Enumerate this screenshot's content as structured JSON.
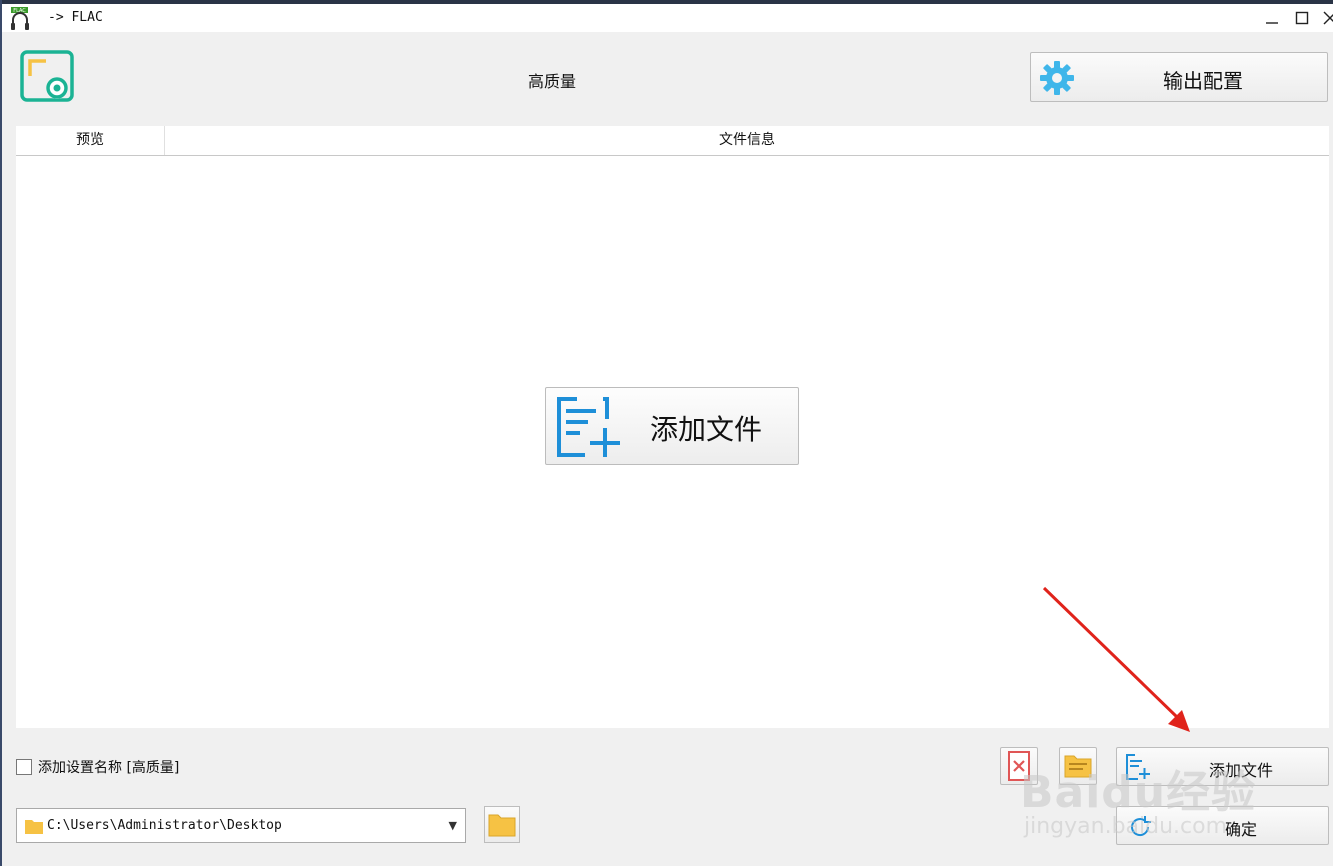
{
  "window": {
    "title": "-> FLAC",
    "app_icon_badge": "FLAC"
  },
  "header": {
    "preset_name": "高质量",
    "output_config_label": "输出配置"
  },
  "file_list": {
    "columns": [
      "预览",
      "文件信息"
    ],
    "add_file_button": "添加文件"
  },
  "footer": {
    "add_setting_name_label": "添加设置名称 [高质量]",
    "add_setting_name_checked": false,
    "add_file_small_label": "添加文件",
    "output_path": "C:\\Users\\Administrator\\Desktop",
    "ok_label": "确定"
  },
  "icons": [
    "app-headphones-icon",
    "minimize-icon",
    "maximize-icon",
    "close-icon",
    "preset-screen-icon",
    "gear-icon",
    "add-file-icon",
    "remove-file-icon",
    "folder-list-icon",
    "folder-icon",
    "browse-folder-icon",
    "refresh-icon"
  ],
  "watermark": {
    "brand": "Baidu经验",
    "site": "jingyan.baidu.com"
  },
  "colors": {
    "teal": "#1bb394",
    "blue": "#1e8fd8",
    "gear": "#3fb6ea",
    "folder": "#f6c244",
    "red_arrow": "#e0231b"
  }
}
